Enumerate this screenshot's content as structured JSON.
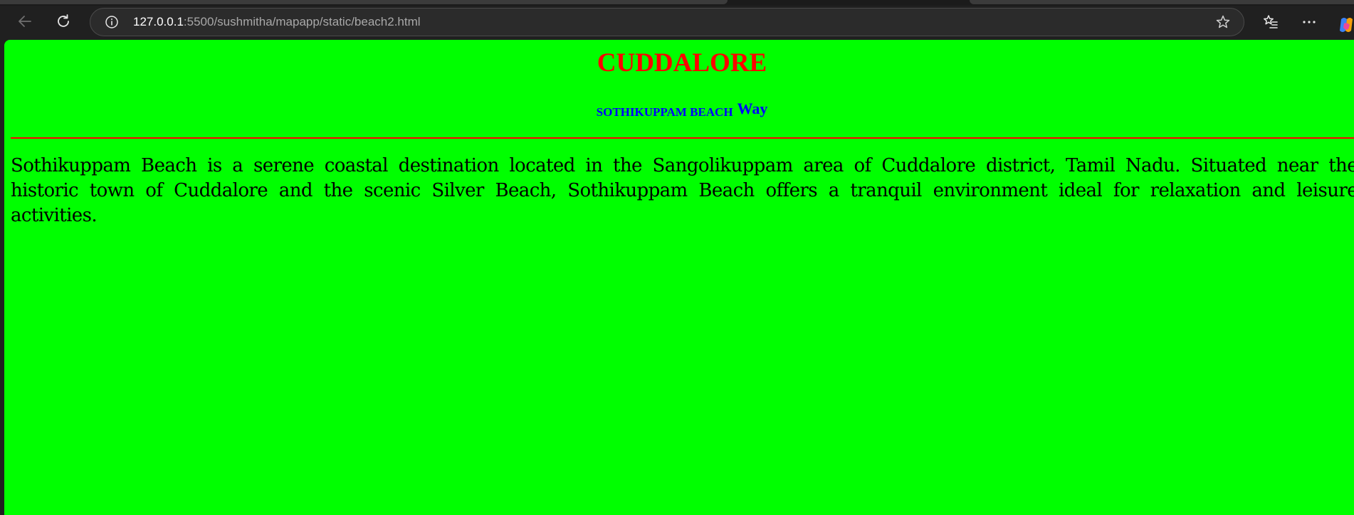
{
  "browser": {
    "address_host": "127.0.0.1",
    "address_path": ":5500/sushmitha/mapapp/static/beach2.html",
    "icons": {
      "back": "back-arrow-icon",
      "reload": "reload-icon",
      "site_info": "info-icon",
      "favorite": "star-icon",
      "favorites_list": "favorites-icon",
      "more": "more-icon",
      "copilot": "copilot-icon"
    }
  },
  "page": {
    "title": "CUDDALORE",
    "subtitle_small": "SOTHIKUPPAM BEACH",
    "subtitle_big": "Way",
    "description": "Sothikuppam Beach is a serene coastal destination located in the Sangolikuppam area of Cuddalore district, Tamil Nadu. Situated near the historic town of Cuddalore and the scenic Silver Beach, Sothikuppam Beach offers a tranquil environment ideal for relaxation and leisure activities."
  },
  "colors": {
    "page_background": "#00ff00",
    "title": "#ff0000",
    "subtitle": "#0000ff",
    "divider": "#ff0000",
    "body_text": "#000000",
    "browser_chrome": "#202020"
  }
}
